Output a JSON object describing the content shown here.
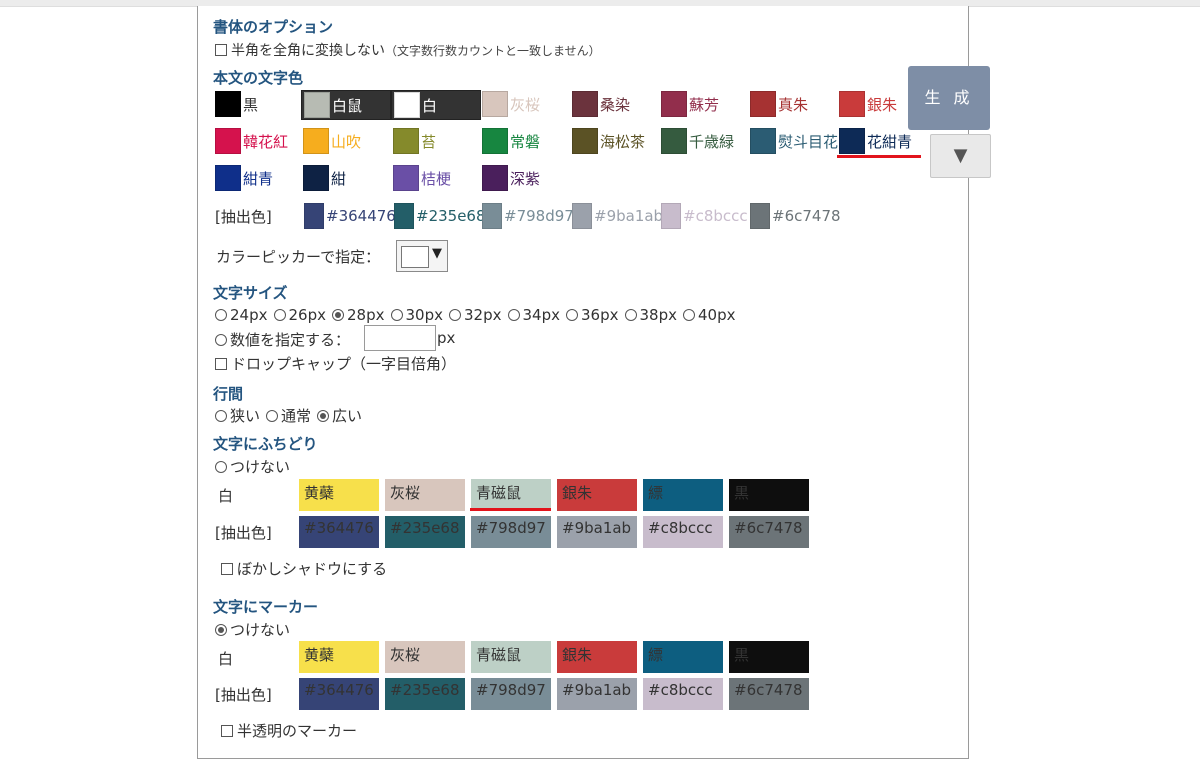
{
  "font_options": {
    "title": "書体のオプション",
    "no_convert": "半角を全角に変換しない",
    "no_convert_note": "（文字数行数カウントと一致しません）"
  },
  "text_color": {
    "title": "本文の文字色",
    "swatches": [
      {
        "label": "黒",
        "color": "#000000",
        "text": "#333333"
      },
      {
        "label": "白鼠",
        "color": "#b7bbb3",
        "text": "#ffffff"
      },
      {
        "label": "白",
        "color": "#ffffff",
        "text": "#ffffff"
      },
      {
        "label": "灰桜",
        "color": "#d8c6bd",
        "text": "#d8c6bd"
      },
      {
        "label": "桑染",
        "color": "#6b333d",
        "text": "#6b333d"
      },
      {
        "label": "蘇芳",
        "color": "#922e4c",
        "text": "#922e4c"
      },
      {
        "label": "真朱",
        "color": "#a63232",
        "text": "#a63232"
      },
      {
        "label": "銀朱",
        "color": "#c93b3b",
        "text": "#c93b3b"
      },
      {
        "label": "韓花紅",
        "color": "#d5124d",
        "text": "#d5124d"
      },
      {
        "label": "山吹",
        "color": "#f6ad1e",
        "text": "#f6ad1e"
      },
      {
        "label": "苔",
        "color": "#858a2b",
        "text": "#858a2b"
      },
      {
        "label": "常磐",
        "color": "#178640",
        "text": "#178640"
      },
      {
        "label": "海松茶",
        "color": "#5b5225",
        "text": "#5b5225"
      },
      {
        "label": "千歳緑",
        "color": "#355b3f",
        "text": "#355b3f"
      },
      {
        "label": "熨斗目花",
        "color": "#2b5c73",
        "text": "#2b5c73"
      },
      {
        "label": "花紺青",
        "color": "#0d2a56",
        "text": "#0d2a56"
      },
      {
        "label": "紺青",
        "color": "#0f2f8a",
        "text": "#0f2f8a"
      },
      {
        "label": "紺",
        "color": "#0e2244",
        "text": "#0e2244"
      },
      {
        "label": "桔梗",
        "color": "#6a4fa6",
        "text": "#6a4fa6"
      },
      {
        "label": "深紫",
        "color": "#4a1f5c",
        "text": "#4a1f5c"
      }
    ],
    "extracted_label": "[抽出色]",
    "extracted": [
      {
        "hex": "#364476",
        "color": "#364476"
      },
      {
        "hex": "#235e68",
        "color": "#235e68"
      },
      {
        "hex": "#798d97",
        "color": "#798d97"
      },
      {
        "hex": "#9ba1ab",
        "color": "#9ba1ab"
      },
      {
        "hex": "#c8bccc",
        "color": "#c8bccc"
      },
      {
        "hex": "#6c7478",
        "color": "#6c7478"
      }
    ],
    "picker_label": "カラーピッカーで指定："
  },
  "font_size": {
    "title": "文字サイズ",
    "options": [
      "24px",
      "26px",
      "28px",
      "30px",
      "32px",
      "34px",
      "36px",
      "38px",
      "40px"
    ],
    "selected": "28px",
    "custom_label": "数値を指定する：",
    "custom_unit": "px",
    "drop_cap": "ドロップキャップ（一字目倍角）"
  },
  "line_spacing": {
    "title": "行間",
    "options": [
      "狭い",
      "通常",
      "広い"
    ],
    "selected": "広い"
  },
  "outline": {
    "title": "文字にふちどり",
    "none_label": "つけない",
    "row1_label": "白",
    "row1": [
      {
        "label": "黄蘗",
        "color": "#f7e04b",
        "text": "#333333"
      },
      {
        "label": "灰桜",
        "color": "#d8c6bd",
        "text": "#333333"
      },
      {
        "label": "青磁鼠",
        "color": "#bdd0c6",
        "text": "#333333"
      },
      {
        "label": "銀朱",
        "color": "#c93b3b",
        "text": "#333333"
      },
      {
        "label": "縹",
        "color": "#0d5e80",
        "text": "#333333"
      },
      {
        "label": "黒",
        "color": "#0e0e0e",
        "text": "#333333"
      }
    ],
    "row2_label": "[抽出色]",
    "row2": [
      {
        "label": "#364476",
        "color": "#364476",
        "text": "#333333"
      },
      {
        "label": "#235e68",
        "color": "#235e68",
        "text": "#333333"
      },
      {
        "label": "#798d97",
        "color": "#798d97",
        "text": "#333333"
      },
      {
        "label": "#9ba1ab",
        "color": "#9ba1ab",
        "text": "#333333"
      },
      {
        "label": "#c8bccc",
        "color": "#c8bccc",
        "text": "#333333"
      },
      {
        "label": "#6c7478",
        "color": "#6c7478",
        "text": "#333333"
      }
    ],
    "blur_shadow": "ぼかしシャドウにする"
  },
  "marker": {
    "title": "文字にマーカー",
    "none_label": "つけない",
    "row1_label": "白",
    "row2_label": "[抽出色]",
    "translucent": "半透明のマーカー"
  },
  "actions": {
    "generate": "生 成",
    "dropdown": "▼"
  },
  "colors": {
    "heading": "#245580",
    "highlight_underline": "#e2141c",
    "generate_bg": "#7e8ea6"
  }
}
